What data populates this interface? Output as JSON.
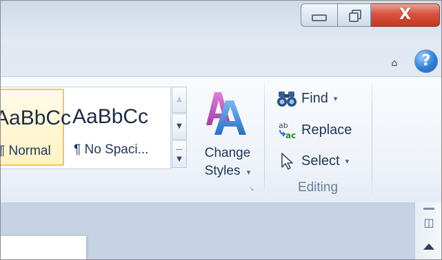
{
  "window": {
    "buttons": {
      "minimize_icon": "minimize-icon",
      "maximize_icon": "restore-icon",
      "close_glyph": "X"
    }
  },
  "ribbon_tabs": {
    "collapse_glyph": "⌂",
    "help_glyph": "?"
  },
  "styles_group": {
    "quick_styles": [
      {
        "sample": "AaBbCc",
        "name": "¶ Normal",
        "selected": true
      },
      {
        "sample": "AaBbCc",
        "name": "¶ No Spaci...",
        "selected": false
      }
    ],
    "scroll_up_glyph": "▲",
    "scroll_down_glyph": "▼",
    "more_glyph": "▼",
    "change_styles": {
      "line1": "Change",
      "line2": "Styles",
      "caret": "▾"
    },
    "launcher_glyph": "↘"
  },
  "editing_group": {
    "label": "Editing",
    "find": {
      "label": "Find",
      "caret": "▾",
      "icon": "binoculars-icon"
    },
    "replace": {
      "label": "Replace",
      "icon": "replace-icon"
    },
    "select": {
      "label": "Select",
      "caret": "▾",
      "icon": "cursor-arrow-icon"
    }
  },
  "colors": {
    "accent_blue": "#2f7fd7",
    "close_red": "#c5371f",
    "selected_style_border": "#f3c552",
    "label_text": "#1f3658"
  }
}
